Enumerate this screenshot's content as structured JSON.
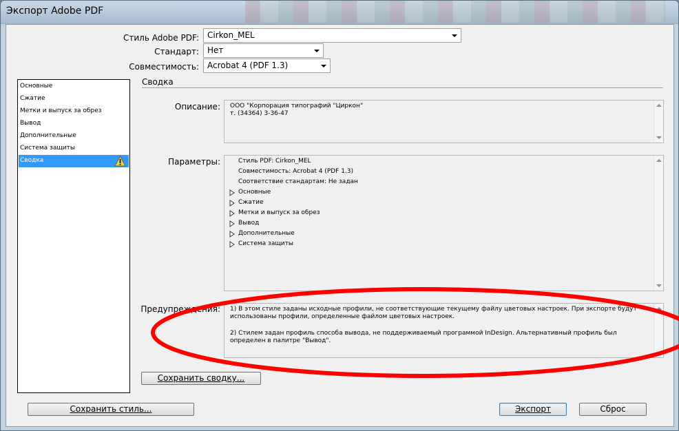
{
  "window": {
    "title": "Экспорт Adobe PDF"
  },
  "header": {
    "preset_label": "Стиль Adobe PDF:",
    "preset_value": "Cirkon_MEL",
    "standard_label": "Стандарт:",
    "standard_value": "Нет",
    "compat_label": "Совместимость:",
    "compat_value": "Acrobat 4 (PDF 1.3)"
  },
  "sidebar": {
    "items": [
      {
        "label": "Основные"
      },
      {
        "label": "Сжатие"
      },
      {
        "label": "Метки и выпуск за обрез"
      },
      {
        "label": "Вывод"
      },
      {
        "label": "Дополнительные"
      },
      {
        "label": "Система защиты"
      },
      {
        "label": "Сводка"
      }
    ],
    "selected_index": 6,
    "warning_icon": "warning-triangle-icon"
  },
  "summary": {
    "section_title": "Сводка",
    "description_label": "Описание:",
    "description_text": "ООО \"Корпорация типографий \"Циркон\"\nт. (34364) 3-36-47",
    "params_label": "Параметры:",
    "params_lines": [
      "Стиль PDF: Cirkon_MEL",
      "Совместимость: Acrobat 4 (PDF 1.3)",
      "Соответствие стандартам: Не задан"
    ],
    "params_groups": [
      "Основные",
      "Сжатие",
      "Метки и выпуск за обрез",
      "Вывод",
      "Дополнительные",
      "Система защиты"
    ],
    "warnings_label": "Предупреждения:",
    "warnings": [
      "1) В этом стиле заданы исходные профили, не соответствующие текущему файлу цветовых настроек. При экспорте будут использованы профили, определенные файлом цветовых настроек.",
      "2) Стилем задан профиль способа вывода, не поддерживаемый программой InDesign. Альтернативный профиль был определен в палитре \"Вывод\"."
    ],
    "save_summary_button": "Сохранить сводку..."
  },
  "footer": {
    "save_preset_button": "Сохранить стиль...",
    "export_button": "Экспорт",
    "reset_button": "Сброс"
  },
  "colors": {
    "selection": "#3399ff",
    "annotation": "#ff0000"
  }
}
